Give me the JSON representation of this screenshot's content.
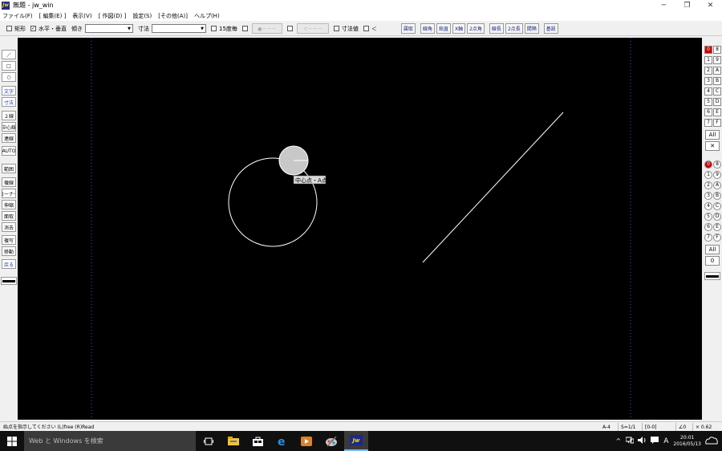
{
  "window": {
    "title": "無題 - jw_win",
    "app_icon": "Jw"
  },
  "menu": [
    "ファイル(F)",
    "[ 編集(E) ]",
    "表示(V)",
    "[ 作図(D) ]",
    "設定(S)",
    "[その他(A)]",
    "ヘルプ(H)"
  ],
  "toolbar": {
    "rect_label": "矩形",
    "rect_checked": false,
    "hv_label": "水平・垂直",
    "hv_checked": true,
    "incline_label": "傾き",
    "incline_value": "",
    "dimension_label": "寸法",
    "dimension_value": "",
    "deg15_label": "15度毎",
    "deg15_checked": false,
    "dot_btn": "●－－－",
    "arrow_btn": "＜－－－",
    "dimvalue_label": "寸法値",
    "dimvalue_checked": false,
    "lt_label": "＜",
    "lt_checked": false,
    "buttons": [
      "属取",
      "線角",
      "鉛直",
      "X軸",
      "2点角",
      "線長",
      "2点長",
      "間隔",
      "基設"
    ]
  },
  "left_tools": [
    "／",
    "□",
    "○",
    "文字",
    "寸法",
    "２線",
    "中心線",
    "連線",
    "AUTO",
    "範囲",
    "複線",
    "コーナー",
    "伸縮",
    "面取",
    "消去",
    "複写",
    "移動",
    "戻る"
  ],
  "right_layers": {
    "group_row_labels": [
      "0",
      "8",
      "1",
      "9",
      "2",
      "A",
      "3",
      "B",
      "4",
      "C",
      "5",
      "D",
      "6",
      "E",
      "7",
      "F"
    ],
    "all_label": "All",
    "x_label": "✕",
    "layer_row_labels": [
      "0",
      "8",
      "1",
      "9",
      "2",
      "A",
      "3",
      "B",
      "4",
      "C",
      "5",
      "D",
      "6",
      "E",
      "7",
      "F"
    ],
    "all2_label": "All",
    "zero_label": "0"
  },
  "canvas": {
    "cursor_tooltip": "中心点・A点"
  },
  "statusbar": {
    "message": "始点を指示してください (L)free (R)Read",
    "paper": "A-4",
    "scale": "S=1/1",
    "layer": "[0-0]",
    "angle": "∠0",
    "zoom": "× 0.62"
  },
  "taskbar": {
    "search_placeholder": "Web と Windows を検索",
    "ime": "A",
    "time": "20:01",
    "date": "2016/05/13"
  },
  "colors": {
    "canvas_bg": "#000000",
    "guide_line": "#8a2be2",
    "drawing": "#ffffff",
    "selected_layer": "#cc0000",
    "link_blue": "#1a3aa8"
  }
}
